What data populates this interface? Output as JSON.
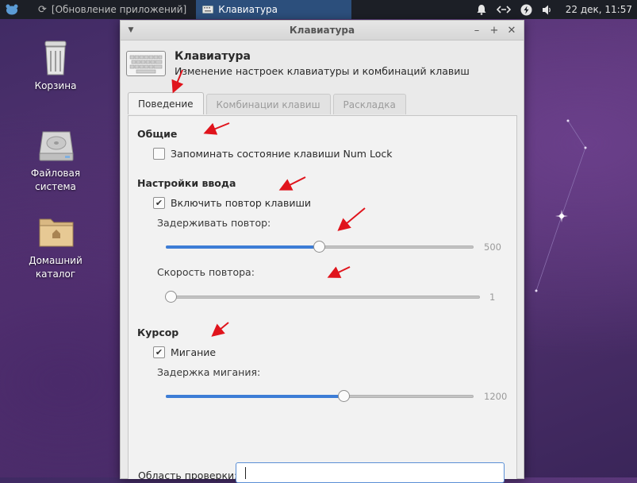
{
  "panel": {
    "tasks": [
      {
        "label": "[Обновление приложений]"
      },
      {
        "label": "Клавиатура"
      }
    ],
    "clock": "22 дек, 11:57"
  },
  "desktop": {
    "icons": [
      {
        "label": "Корзина"
      },
      {
        "label": "Файловая система"
      },
      {
        "label": "Домашний каталог"
      }
    ]
  },
  "window": {
    "title": "Клавиатура",
    "header_title": "Клавиатура",
    "header_subtitle": "Изменение настроек клавиатуры и комбинаций клавиш",
    "tabs": [
      {
        "label": "Поведение"
      },
      {
        "label": "Комбинации клавиш"
      },
      {
        "label": "Раскладка"
      }
    ],
    "general": {
      "heading": "Общие",
      "numlock_label": "Запоминать состояние клавиши Num Lock",
      "numlock_checked": false
    },
    "input": {
      "heading": "Настройки ввода",
      "repeat_label": "Включить повтор клавиши",
      "repeat_checked": true,
      "delay_label": "Задерживать повтор:",
      "delay_value": "500",
      "delay_fraction": 0.5,
      "speed_label": "Скорость повтора:",
      "speed_value": "1",
      "speed_fraction": 0.0
    },
    "cursor": {
      "heading": "Курсор",
      "blink_label": "Мигание",
      "blink_checked": true,
      "blink_delay_label": "Задержка мигания:",
      "blink_delay_value": "1200",
      "blink_delay_fraction": 0.58
    },
    "test_area_label": "Область проверки:",
    "test_area_value": ""
  },
  "colors": {
    "accent": "#3d7dd6",
    "annotation_arrow": "#e0141c"
  }
}
